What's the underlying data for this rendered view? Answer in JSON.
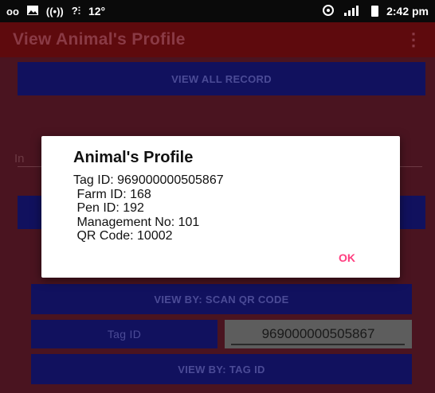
{
  "status_bar": {
    "left_icons": [
      "voicemail-icon",
      "image-icon",
      "hotspot-icon",
      "signal-icon"
    ],
    "voicemail_glyph": "ᴏᴏ",
    "hotspot_glyph": "((•))",
    "signal_glyph": "?⫶",
    "temperature": "12°",
    "time": "2:42 pm"
  },
  "app_bar": {
    "title": "View Animal's Profile",
    "menu_glyph": "⋮"
  },
  "main": {
    "view_all_label": "VIEW ALL RECORD",
    "input_hint": "In",
    "scan_qr_label": "VIEW BY: SCAN QR CODE",
    "tag_id_label": "Tag ID",
    "tag_id_value": "969000000505867",
    "view_by_tag_label": "VIEW BY: TAG ID"
  },
  "dialog": {
    "title": "Animal's Profile",
    "body": "Tag ID: 969000000505867\n Farm ID: 168\n Pen ID: 192\n Management No: 101\n QR Code: 10002",
    "ok_label": "OK"
  },
  "colors": {
    "status_bar": "#0a0a0a",
    "app_bar": "#5e0a0d",
    "background_dimmed": "#4a1420",
    "button_dimmed": "#11115e",
    "ok_accent": "#ff3d7f"
  }
}
